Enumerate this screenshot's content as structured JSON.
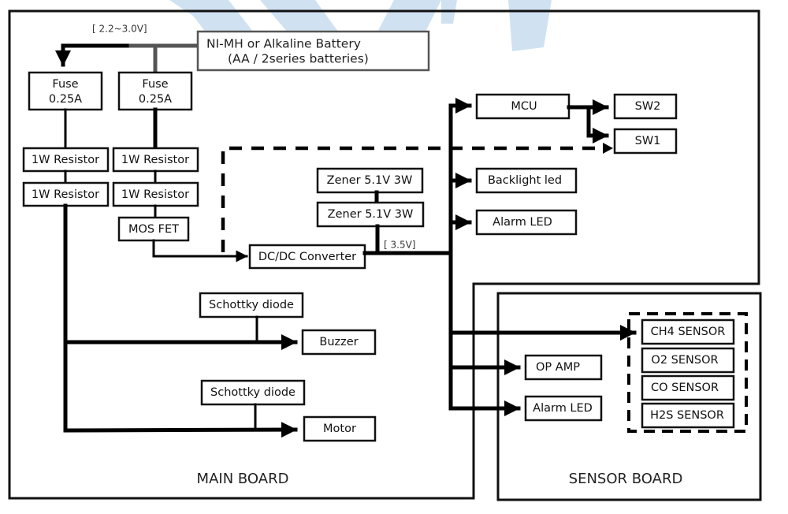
{
  "diagram": {
    "watermark": "KEIT",
    "boards": {
      "main": "MAIN BOARD",
      "sensor": "SENSOR BOARD"
    },
    "battery": {
      "line1": "NI-MH or Alkaline Battery",
      "line2": "(AA / 2series batteries)",
      "voltage_label": "[ 2.2~3.0V]"
    },
    "main_board": {
      "fuse_left": {
        "line1": "Fuse",
        "line2": "0.25A"
      },
      "fuse_right": {
        "line1": "Fuse",
        "line2": "0.25A"
      },
      "resistor_left_1": "1W Resistor",
      "resistor_left_2": "1W Resistor",
      "resistor_right_1": "1W Resistor",
      "resistor_right_2": "1W Resistor",
      "mosfet": "MOS FET",
      "dcdc": "DC/DC Converter",
      "zener_1": "Zener  5.1V 3W",
      "zener_2": "Zener  5.1V 3W",
      "dcdc_output_label": "[ 3.5V]",
      "mcu": "MCU",
      "sw2": "SW2",
      "sw1": "SW1",
      "backlight": "Backlight led",
      "alarm_led": "Alarm LED",
      "schottky_1": "Schottky diode",
      "buzzer": "Buzzer",
      "schottky_2": "Schottky diode",
      "motor": "Motor"
    },
    "sensor_board": {
      "op_amp": "OP AMP",
      "alarm_led": "Alarm LED",
      "sensors": [
        "CH4 SENSOR",
        "O2 SENSOR",
        "CO SENSOR",
        "H2S SENSOR"
      ]
    },
    "colors": {
      "line": "#000000",
      "battery_wire": "#555555",
      "watermark": "#a9c8e8"
    }
  }
}
